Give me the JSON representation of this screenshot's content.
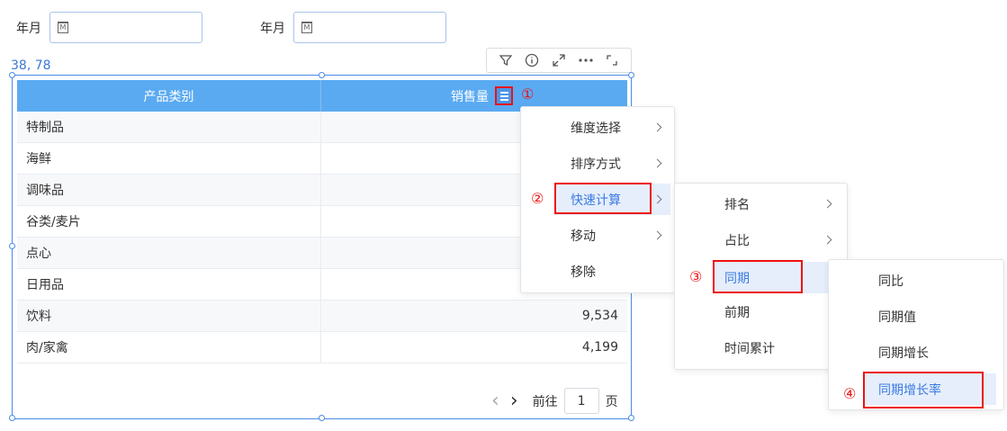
{
  "filters": [
    {
      "label": "年月",
      "icon": "calendar-icon",
      "icon_glyph": "M"
    },
    {
      "label": "年月",
      "icon": "calendar-icon",
      "icon_glyph": "M"
    }
  ],
  "coord_text": "38, 78",
  "toolbar": {
    "icons": [
      "filter-icon",
      "info-icon",
      "expand-icon",
      "more-icon",
      "collapse-icon"
    ]
  },
  "table": {
    "headers": [
      "产品类别",
      "销售量"
    ],
    "rows": [
      {
        "category": "特制品",
        "value": ""
      },
      {
        "category": "海鲜",
        "value": ""
      },
      {
        "category": "调味品",
        "value": ""
      },
      {
        "category": "谷类/麦片",
        "value": ""
      },
      {
        "category": "点心",
        "value": ""
      },
      {
        "category": "日用品",
        "value": ""
      },
      {
        "category": "饮料",
        "value": "9,534"
      },
      {
        "category": "肉/家禽",
        "value": "4,199"
      }
    ]
  },
  "markers": {
    "m1": "①",
    "m2": "②",
    "m3": "③",
    "m4": "④"
  },
  "pager": {
    "prev": "‹",
    "next": "›",
    "goto": "前往",
    "page": "1",
    "page_unit": "页"
  },
  "menu1": {
    "items": [
      "维度选择",
      "排序方式",
      "快速计算",
      "移动",
      "移除"
    ]
  },
  "menu2": {
    "items": [
      "排名",
      "占比",
      "同期",
      "前期",
      "时间累计"
    ]
  },
  "menu3": {
    "items": [
      "同比",
      "同期值",
      "同期增长",
      "同期增长率"
    ]
  },
  "colors": {
    "header": "#5aaaf2",
    "accent": "#3a7be0",
    "annotation": "#e11111"
  }
}
